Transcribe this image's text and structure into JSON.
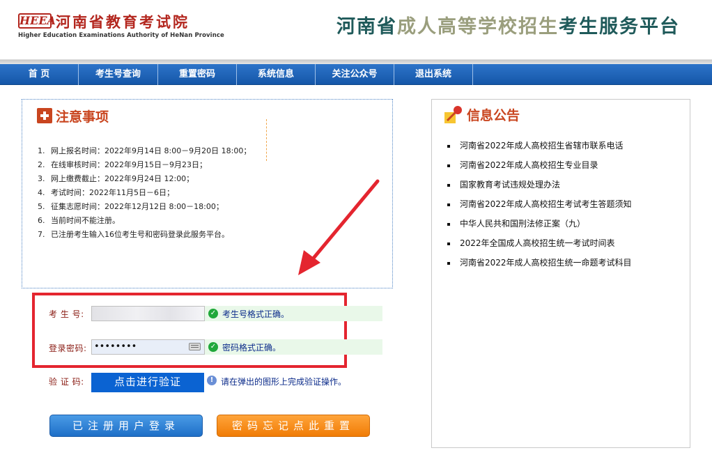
{
  "header": {
    "logo_mark": "HEEA",
    "org_name": "河南省教育考试院",
    "org_name_en": "Higher Education Examinations Authority of HeNan Province",
    "site_title_part1": "河南省",
    "site_title_part2": "成人高等学校招生",
    "site_title_part3": "考生服务平台"
  },
  "nav": {
    "items": [
      {
        "label": "首  页"
      },
      {
        "label": "考生号查询"
      },
      {
        "label": "重置密码"
      },
      {
        "label": "系统信息"
      },
      {
        "label": "关注公众号"
      },
      {
        "label": "退出系统"
      }
    ]
  },
  "notice": {
    "title": "注意事项",
    "items": [
      {
        "num": "1.",
        "text": "网上报名时间：2022年9月14日 8:00－9月20日 18:00；"
      },
      {
        "num": "2.",
        "text": "在线审核时间：2022年9月15日－9月23日；"
      },
      {
        "num": "3.",
        "text": "网上缴费截止：2022年9月24日 12:00；"
      },
      {
        "num": "4.",
        "text": "考试时间：2022年11月5日－6日；"
      },
      {
        "num": "5.",
        "text": "征集志愿时间：2022年12月12日 8:00－18:00；"
      },
      {
        "num": "6.",
        "text": "当前时间不能注册。"
      },
      {
        "num": "7.",
        "text": "已注册考生输入16位考生号和密码登录此服务平台。"
      }
    ]
  },
  "login": {
    "student_id_label": "考 生 号:",
    "student_id_value": "",
    "student_id_ok": "考生号格式正确。",
    "password_label": "登录密码:",
    "password_value": "••••••••",
    "password_ok": "密码格式正确。",
    "captcha_label": "验 证 码:",
    "captcha_button": "点击进行验证",
    "captcha_hint": "请在弹出的图形上完成验证操作。",
    "login_button": "已注册用户登录",
    "reset_button": "密码忘记点此重置"
  },
  "announce": {
    "title": "信息公告",
    "items": [
      "河南省2022年成人高校招生省辖市联系电话",
      "河南省2022年成人高校招生专业目录",
      "国家教育考试违规处理办法",
      "河南省2022年成人高校招生考试考生答题须知",
      "中华人民共和国刑法修正案（九）",
      "2022年全国成人高校招生统一考试时间表",
      "河南省2022年成人高校招生统一命题考试科目"
    ]
  },
  "colors": {
    "nav_blue": "#1557a8",
    "accent_red": "#c9451f",
    "frame_red": "#e4252f",
    "ok_green": "#20a83a",
    "verify_blue": "#0b63d2",
    "login_blue": "#1e6fc7",
    "reset_orange": "#f07c06"
  },
  "icons": [
    "heea-logo",
    "plus-icon",
    "pin-icon",
    "check-icon",
    "info-icon",
    "keyboard-icon",
    "red-arrow-annotation"
  ]
}
